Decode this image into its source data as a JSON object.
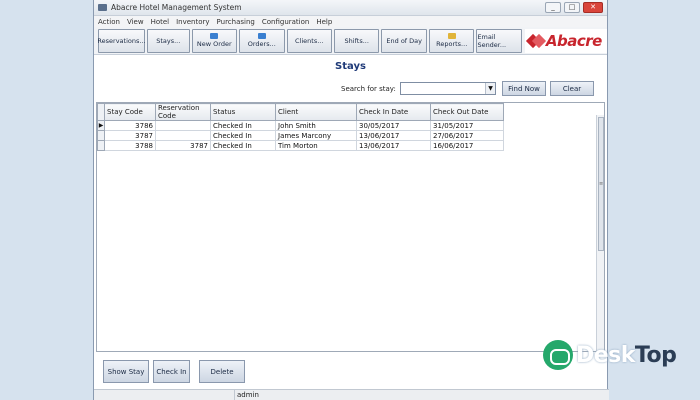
{
  "window": {
    "title": "Abacre Hotel Management System",
    "buttons": {
      "minimize": "_",
      "maximize": "□",
      "close": "✕"
    }
  },
  "menu": [
    "Action",
    "View",
    "Hotel",
    "Inventory",
    "Purchasing",
    "Configuration",
    "Help"
  ],
  "toolbar": [
    {
      "label": "Reservations...",
      "icon": "",
      "icon_color": ""
    },
    {
      "label": "Stays...",
      "icon": "",
      "icon_color": ""
    },
    {
      "label": "New Order",
      "icon": "new-order-icon",
      "icon_color": "#3a7fd0"
    },
    {
      "label": "Orders...",
      "icon": "orders-icon",
      "icon_color": "#3a7fd0"
    },
    {
      "label": "Clients...",
      "icon": "",
      "icon_color": ""
    },
    {
      "label": "Shifts...",
      "icon": "",
      "icon_color": ""
    },
    {
      "label": "End of Day",
      "icon": "",
      "icon_color": ""
    },
    {
      "label": "Reports...",
      "icon": "reports-icon",
      "icon_color": "#e0b43a"
    },
    {
      "label": "Email Sender...",
      "icon": "",
      "icon_color": ""
    }
  ],
  "logo": {
    "text": "Abacre",
    "color": "#c8252d"
  },
  "page": {
    "title": "Stays"
  },
  "search": {
    "label": "Search for stay:",
    "value": "",
    "dropdown_arrow": "▼",
    "find_label": "Find Now",
    "clear_label": "Clear"
  },
  "grid": {
    "columns": [
      "Stay Code",
      "Reservation Code",
      "Status",
      "Client",
      "Check In Date",
      "Check Out Date"
    ],
    "rows": [
      [
        "3786",
        "",
        "Checked In",
        "John Smith",
        "30/05/2017",
        "31/05/2017"
      ],
      [
        "3787",
        "",
        "Checked In",
        "James Marcony",
        "13/06/2017",
        "27/06/2017"
      ],
      [
        "3788",
        "3787",
        "Checked In",
        "Tim Morton",
        "13/06/2017",
        "16/06/2017"
      ]
    ],
    "current_row_marker": "▶"
  },
  "actions": {
    "show_stay": "Show Stay",
    "check_in": "Check In",
    "delete": "Delete"
  },
  "status": {
    "user": "admin"
  },
  "watermark": {
    "part1": "Desk",
    "part2": "Top"
  }
}
